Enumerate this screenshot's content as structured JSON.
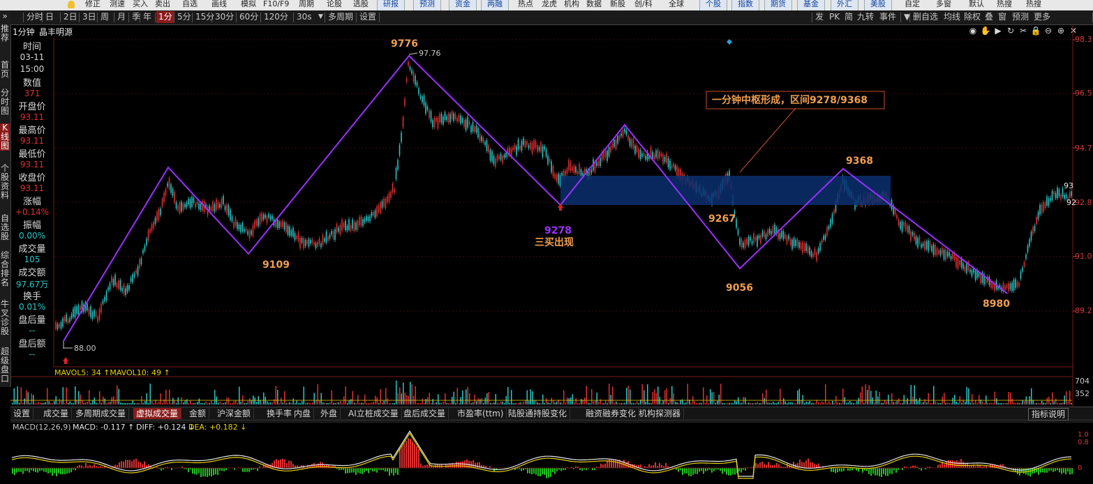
{
  "top_menu": {
    "items": [
      "修正",
      "测速",
      "买入",
      "卖出",
      "自选",
      "画线",
      "模拟",
      "F10/F9",
      "周期",
      "论股",
      "选股"
    ],
    "buttons": [
      "研报",
      "预测",
      "资金",
      "两融"
    ],
    "items2": [
      "热点",
      "龙虎",
      "机构",
      "数据",
      "新股",
      "创/科",
      "全球"
    ],
    "buttons2": [
      "个股",
      "指数",
      "期货",
      "基金",
      "外汇",
      "美股"
    ],
    "items3": [
      "自定",
      "多窗",
      "默认",
      "热搜",
      "热搜"
    ]
  },
  "toolbar": {
    "periods": [
      "分时",
      "日",
      "2日",
      "3日",
      "周",
      "月",
      "季",
      "年",
      "1分",
      "5分",
      "15分",
      "30分",
      "60分",
      "120分",
      "30s"
    ],
    "selected_period": "1分",
    "dropdown_arrow": "▼",
    "multi_period": "多周期",
    "settings": "设置",
    "right_items": [
      "发",
      "PK",
      "简",
      "九转",
      "事件",
      "▼",
      "删自选",
      "均线",
      "除权",
      "叠",
      "窗",
      "预测",
      "更多"
    ],
    "chevron": "»"
  },
  "left_nav": [
    {
      "label": "推荐",
      "selected": false
    },
    {
      "label": "首页",
      "selected": false
    },
    {
      "label": "分时图",
      "selected": false
    },
    {
      "label": "K线图",
      "selected": true
    },
    {
      "label": "个股资料",
      "selected": false
    },
    {
      "label": "自选股",
      "selected": false
    },
    {
      "label": "综合排名",
      "selected": false
    },
    {
      "label": "牛叉诊股",
      "selected": false
    },
    {
      "label": "超级盘口",
      "selected": false
    }
  ],
  "header": {
    "period_label": "1分钟",
    "stock_name": "晶丰明源"
  },
  "header_icons": [
    "eye-icon",
    "hand-icon",
    "play-icon",
    "refresh-icon",
    "scissors-icon",
    "lock-icon",
    "zoom-out-icon",
    "zoom-in-icon",
    "close-icon"
  ],
  "info": {
    "time_label": "时间",
    "date": "03-11",
    "time": "15:00",
    "value_label": "数值",
    "value": "371",
    "open_label": "开盘价",
    "open": "93.11",
    "high_label": "最高价",
    "high": "93.11",
    "low_label": "最低价",
    "low": "93.11",
    "close_label": "收盘价",
    "close": "93.11",
    "change_label": "涨幅",
    "change": "+0.14%",
    "amp_label": "振幅",
    "amp": "0.00%",
    "vol_label": "成交量",
    "vol": "105",
    "amt_label": "成交额",
    "amt": "97.67万",
    "turn_label": "换手",
    "turn": "0.01%",
    "after_vol_label": "盘后量",
    "after_vol": "--",
    "after_amt_label": "盘后额",
    "after_amt": "--"
  },
  "price_axis": [
    "98.3",
    "96.5",
    "94.7",
    "92.8",
    "91.0",
    "89.2"
  ],
  "right_edge_labels": [
    "93",
    "92"
  ],
  "annotations": {
    "peak_label": "9776",
    "peak_price": "97.76",
    "low_label": "88.00",
    "p1": "9109",
    "p2": "9278",
    "buy_signal": "三买出现",
    "p3": "9267",
    "p4": "9056",
    "p5": "9368",
    "p6": "8980",
    "callout": "一分钟中枢形成，区间9278/9368"
  },
  "colors": {
    "zigzag": "#9b30ff",
    "zone": "#0b2f6e",
    "up": "#e03030",
    "down": "#28c8c8",
    "label": "#f0a050",
    "callout_border": "#c8502a"
  },
  "volume": {
    "ma_text": "MAVOL5: 34 ↑MAVOL10: 49 ↑",
    "axis": [
      "704",
      "352"
    ]
  },
  "bottom_tabs": {
    "items": [
      "设置",
      "成交量",
      "多周期成交量",
      "虚拟成交量",
      "金额",
      "沪深金额",
      "换手率",
      "内盘",
      "外盘",
      "AI立桩成交量",
      "盘后成交量",
      "市盈率(ttm)",
      "陆股通持股变化",
      "融资融券变化",
      "机构探测器"
    ],
    "selected": "虚拟成交量",
    "right_button": "指标说明"
  },
  "macd": {
    "title": "MACD(12,26,9)",
    "macd_text": "MACD: -0.117 ↑",
    "diff_text": "DIFF: +0.124 ↓",
    "dea_text": "DEA: +0.182 ↓",
    "axis": [
      "1.0",
      "0.8",
      "0"
    ]
  },
  "chart_data": {
    "type": "line",
    "series": [
      {
        "name": "zigzag",
        "x_index": [
          0,
          1,
          2,
          3,
          4,
          5,
          6,
          7,
          8,
          9,
          10
        ],
        "values": [
          88.0,
          94.09,
          91.09,
          97.76,
          92.78,
          95.37,
          92.67,
          90.56,
          93.68,
          89.8,
          93.11
        ]
      }
    ],
    "zone": [
      92.78,
      93.68
    ],
    "ylim": [
      88.0,
      98.5
    ]
  }
}
